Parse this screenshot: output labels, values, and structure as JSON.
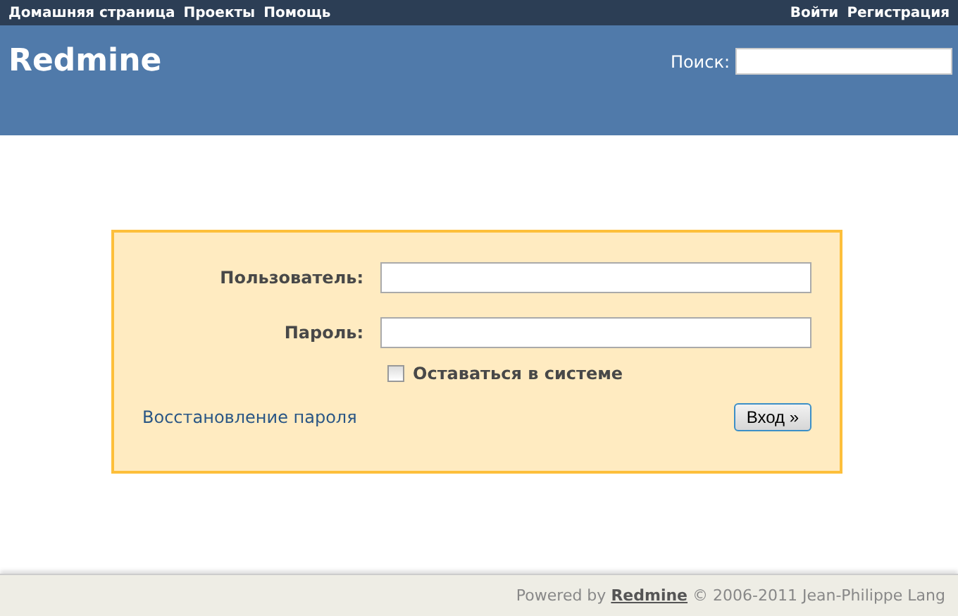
{
  "top_menu": {
    "left": [
      "Домашняя страница",
      "Проекты",
      "Помощь"
    ],
    "right": [
      "Войти",
      "Регистрация"
    ]
  },
  "header": {
    "title": "Redmine",
    "search_label": "Поиск:"
  },
  "login": {
    "username_label": "Пользователь:",
    "password_label": "Пароль:",
    "remember": {
      "label": "Оставаться в системе",
      "checked": false
    },
    "lost_password": "Восстановление пароля",
    "submit": "Вход »"
  },
  "footer": {
    "prefix": "Powered by",
    "link": "Redmine",
    "suffix": "© 2006-2011 Jean-Philippe Lang"
  }
}
